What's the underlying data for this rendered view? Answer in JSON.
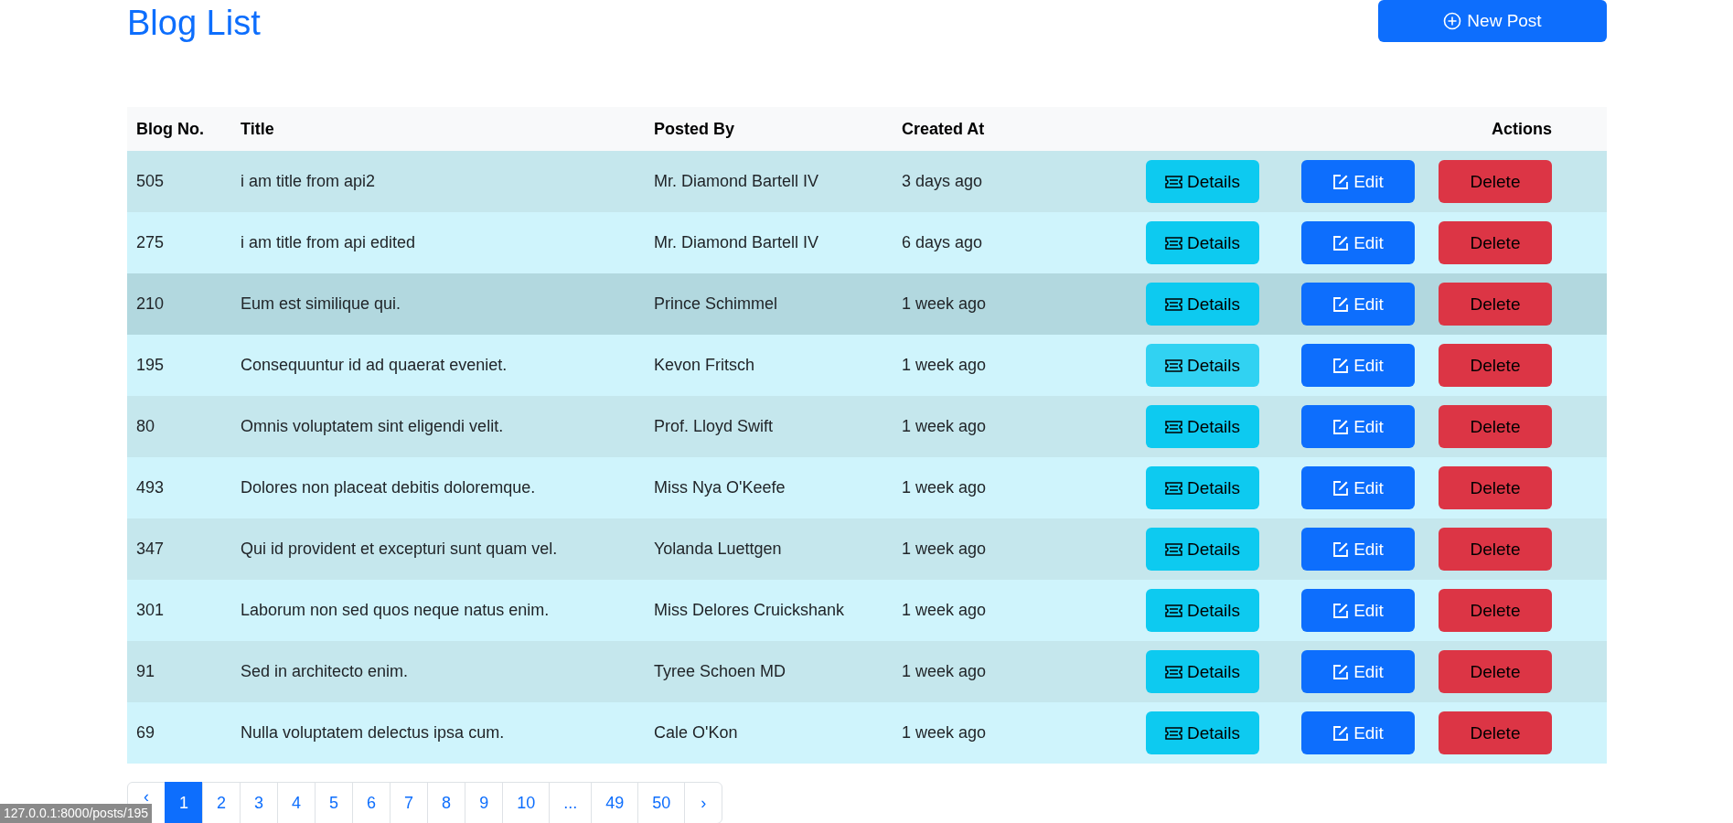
{
  "title": "Blog List",
  "new_post_button": "New Post",
  "table": {
    "columns": [
      "Blog No.",
      "Title",
      "Posted By",
      "Created At",
      "Actions"
    ],
    "rows": [
      {
        "no": "505",
        "title": "i am title from api2",
        "posted_by": "Mr. Diamond Bartell IV",
        "created_at": "3 days ago",
        "hovered": false,
        "details_hovered": false,
        "details": "Details",
        "edit": "Edit",
        "delete": "Delete"
      },
      {
        "no": "275",
        "title": "i am title from api edited",
        "posted_by": "Mr. Diamond Bartell IV",
        "created_at": "6 days ago",
        "hovered": false,
        "details_hovered": false,
        "details": "Details",
        "edit": "Edit",
        "delete": "Delete"
      },
      {
        "no": "210",
        "title": "Eum est similique qui.",
        "posted_by": "Prince Schimmel",
        "created_at": "1 week ago",
        "hovered": true,
        "details_hovered": false,
        "details": "Details",
        "edit": "Edit",
        "delete": "Delete"
      },
      {
        "no": "195",
        "title": "Consequuntur id ad quaerat eveniet.",
        "posted_by": "Kevon Fritsch",
        "created_at": "1 week ago",
        "hovered": false,
        "details_hovered": true,
        "details": "Details",
        "edit": "Edit",
        "delete": "Delete"
      },
      {
        "no": "80",
        "title": "Omnis voluptatem sint eligendi velit.",
        "posted_by": "Prof. Lloyd Swift",
        "created_at": "1 week ago",
        "hovered": false,
        "details_hovered": false,
        "details": "Details",
        "edit": "Edit",
        "delete": "Delete"
      },
      {
        "no": "493",
        "title": "Dolores non placeat debitis doloremque.",
        "posted_by": "Miss Nya O'Keefe",
        "created_at": "1 week ago",
        "hovered": false,
        "details_hovered": false,
        "details": "Details",
        "edit": "Edit",
        "delete": "Delete"
      },
      {
        "no": "347",
        "title": "Qui id provident et excepturi sunt quam vel.",
        "posted_by": "Yolanda Luettgen",
        "created_at": "1 week ago",
        "hovered": false,
        "details_hovered": false,
        "details": "Details",
        "edit": "Edit",
        "delete": "Delete"
      },
      {
        "no": "301",
        "title": "Laborum non sed quos neque natus enim.",
        "posted_by": "Miss Delores Cruickshank",
        "created_at": "1 week ago",
        "hovered": false,
        "details_hovered": false,
        "details": "Details",
        "edit": "Edit",
        "delete": "Delete"
      },
      {
        "no": "91",
        "title": "Sed in architecto enim.",
        "posted_by": "Tyree Schoen MD",
        "created_at": "1 week ago",
        "hovered": false,
        "details_hovered": false,
        "details": "Details",
        "edit": "Edit",
        "delete": "Delete"
      },
      {
        "no": "69",
        "title": "Nulla voluptatem delectus ipsa cum.",
        "posted_by": "Cale O'Kon",
        "created_at": "1 week ago",
        "hovered": false,
        "details_hovered": false,
        "details": "Details",
        "edit": "Edit",
        "delete": "Delete"
      }
    ]
  },
  "pagination": [
    {
      "label": "‹",
      "selected": false
    },
    {
      "label": "1",
      "selected": true
    },
    {
      "label": "2",
      "selected": false
    },
    {
      "label": "3",
      "selected": false
    },
    {
      "label": "4",
      "selected": false
    },
    {
      "label": "5",
      "selected": false
    },
    {
      "label": "6",
      "selected": false
    },
    {
      "label": "7",
      "selected": false
    },
    {
      "label": "8",
      "selected": false
    },
    {
      "label": "9",
      "selected": false
    },
    {
      "label": "10",
      "selected": false
    },
    {
      "label": "...",
      "selected": false
    },
    {
      "label": "49",
      "selected": false
    },
    {
      "label": "50",
      "selected": false
    },
    {
      "label": "›",
      "selected": false
    }
  ],
  "status_bar": {
    "url": "127.0.0.1:8000/posts/195"
  }
}
